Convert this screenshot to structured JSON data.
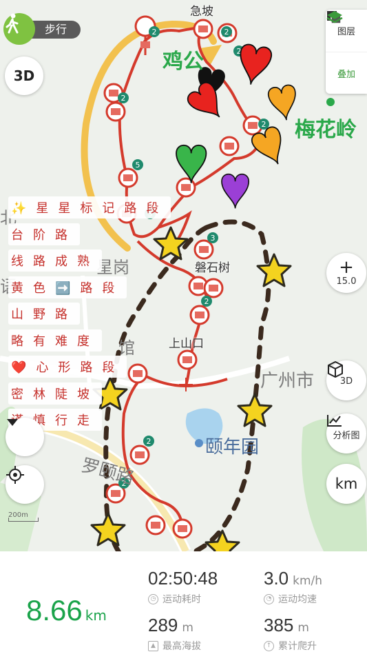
{
  "map": {
    "places": {
      "jipo": "急坡",
      "jigong": "鸡公",
      "meihualing": "梅花岭",
      "panshishu": "磐石树",
      "shangshankou": "上山口",
      "guangzhoushi": "广州市",
      "yinianyuan": "颐年园",
      "luoyinglu": "罗颐路",
      "xinggang": "星岗",
      "bei": "北",
      "yu": "语",
      "guan": "馆"
    },
    "pin_counts": [
      "2",
      "2",
      "2",
      "2",
      "2",
      "5",
      "3",
      "3",
      "2",
      "2",
      "2"
    ],
    "scale_label": "200m"
  },
  "controls": {
    "walk_mode_label": "步行",
    "three_d_label": "3D",
    "layers_label": "图层",
    "overlay_label": "叠加",
    "zoom_level": "15.0",
    "zoom_plus": "+",
    "view_3d_label": "3D",
    "analysis_label": "分析图",
    "unit_toggle_label": "km"
  },
  "legend": [
    "✨星星标记路段",
    "台阶路",
    "线路成熟",
    "黄色➡️路段",
    "山野路",
    "略有难度",
    "❤️心形路段",
    "密林陡坡",
    "谨慎行走"
  ],
  "stats": {
    "distance": {
      "value": "8.66",
      "unit": "km"
    },
    "duration": {
      "value": "02:50:48",
      "label": "运动耗时"
    },
    "speed": {
      "value": "3.0",
      "unit": "km/h",
      "label": "运动均速"
    },
    "altitude": {
      "value": "289",
      "unit": "m",
      "label": "最高海拔"
    },
    "climb": {
      "value": "385",
      "unit": "m",
      "label": "累计爬升"
    }
  },
  "colors": {
    "route": "#d43a2c",
    "arrow_yellow": "#f2c14e",
    "star": "#f4d31f",
    "heart_red": "#e8231f",
    "heart_orange": "#f5a623",
    "heart_green": "#39b54a",
    "heart_purple": "#9b3fd6",
    "heart_black": "#111111",
    "distance_green": "#1aa34a"
  }
}
